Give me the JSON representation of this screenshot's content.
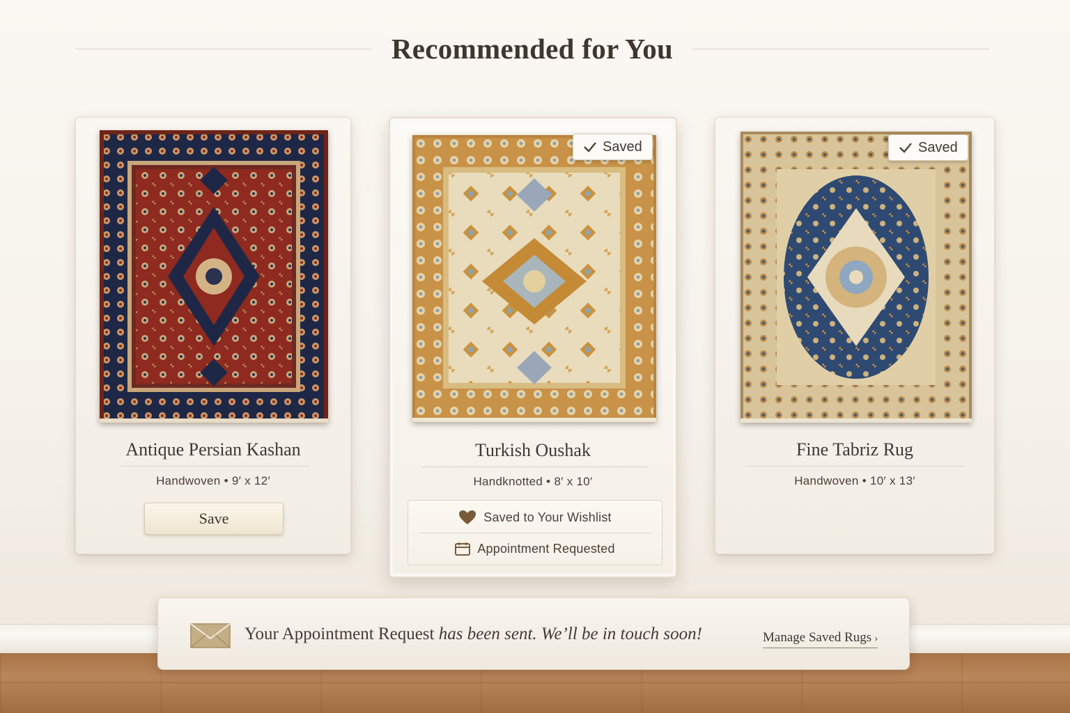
{
  "header": {
    "title": "Recommended for You"
  },
  "colors": {
    "wall": "#f8f4ee",
    "card": "#f7f3ec",
    "text": "#3f3833",
    "heart": "#7a5a3a",
    "floor": "#b07a4d"
  },
  "cards": [
    {
      "title": "Antique Persian Kashan",
      "meta": "Handwoven • 9′ x 12′",
      "button_label": "Save",
      "rug_icon": "red-navy-medallion-rug-image"
    },
    {
      "title": "Turkish Oushak",
      "meta": "Handknotted • 8′ x 10′",
      "badge": "Saved",
      "rug_icon": "ivory-gold-oushak-rug-image",
      "status": {
        "wishlist": "Saved to Your Wishlist",
        "appointment": "Appointment Requested"
      }
    },
    {
      "title": "Fine Tabriz Rug",
      "meta": "Handwoven • 10′ x 13′",
      "badge": "Saved",
      "rug_icon": "navy-ivory-tabriz-rug-image"
    }
  ],
  "notification": {
    "text_lead": "Your Appointment Request",
    "text_rest": "has been sent. We’ll be in touch soon!",
    "link": "Manage Saved Rugs",
    "link_chevron": "›",
    "icon": "envelope-icon"
  }
}
